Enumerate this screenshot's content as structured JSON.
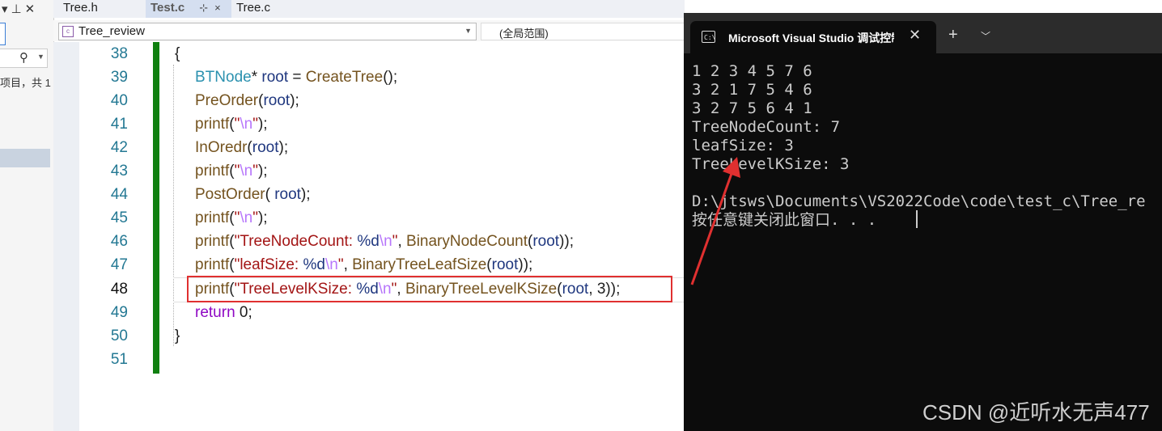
{
  "left_pane": {
    "icons": [
      "chevron-down",
      "pin",
      "close"
    ],
    "status_text": "项目，共 1"
  },
  "tabs": [
    {
      "label": "Tree.h"
    },
    {
      "label": "Test.c",
      "pin": "⊹",
      "close": "×"
    },
    {
      "label": "Tree.c"
    }
  ],
  "nav": {
    "scope": "Tree_review",
    "global": "(全局范围)"
  },
  "editor": {
    "line_numbers": [
      "38",
      "39",
      "40",
      "41",
      "42",
      "43",
      "44",
      "45",
      "46",
      "47",
      "48",
      "49",
      "50",
      "51"
    ],
    "current_line": "48"
  },
  "terminal": {
    "title": "Microsoft Visual Studio 调试控制台",
    "output_lines": [
      "1 2 3 4 5 7 6",
      "3 2 1 7 5 4 6",
      "3 2 7 5 6 4 1",
      "TreeNodeCount: 7",
      "leafSize: 3",
      "TreeLevelKSize: 3",
      "",
      "D:\\jtsws\\Documents\\VS2022Code\\code\\test_c\\Tree_re",
      "按任意键关闭此窗口. . ."
    ]
  },
  "watermark": "CSDN @近听水无声477",
  "colors": {
    "annotation_red": "#e03030",
    "change_bar": "#108010"
  }
}
